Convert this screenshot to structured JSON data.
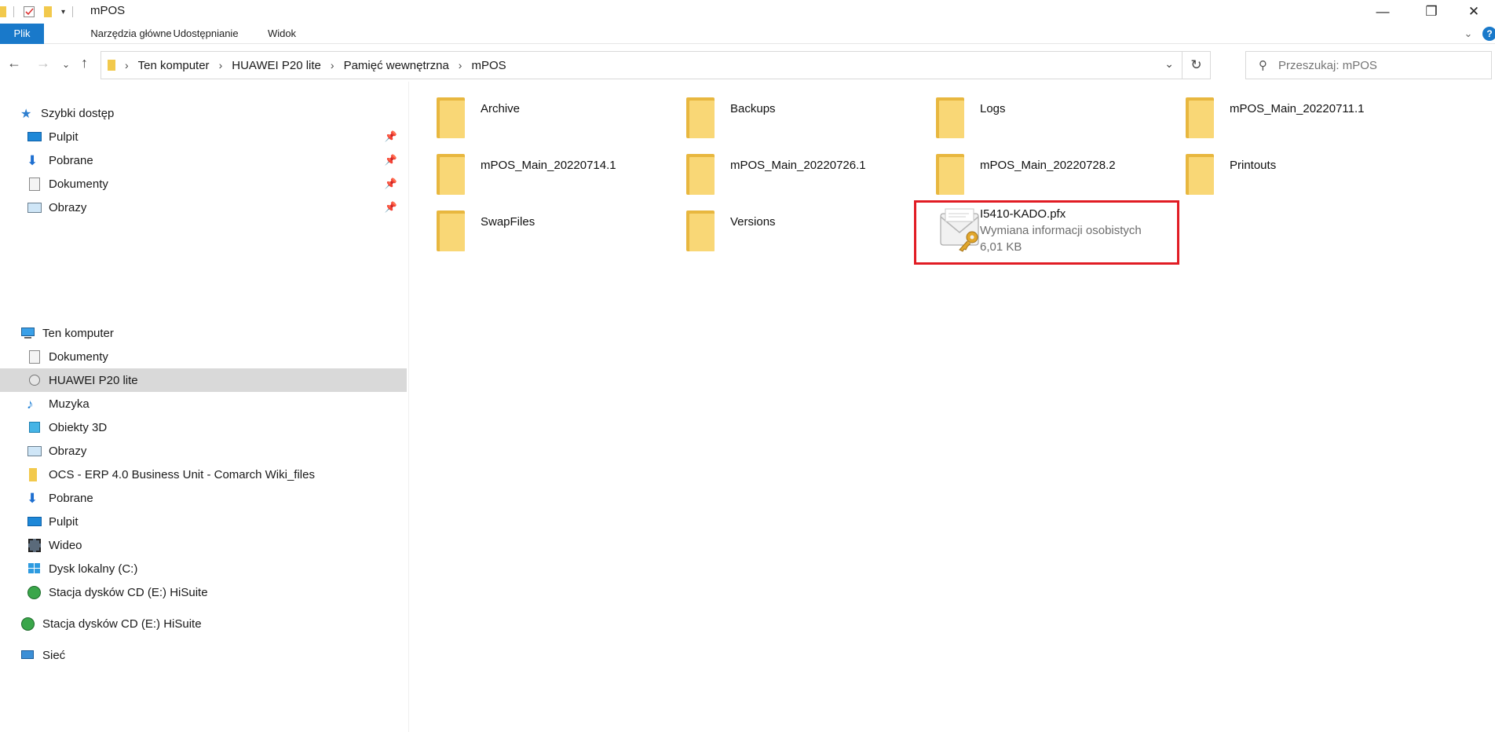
{
  "window": {
    "title": "mPOS",
    "minimize_glyph": "—",
    "restore_glyph": "❐",
    "close_glyph": "✕"
  },
  "ribbon": {
    "tabs": [
      "Plik",
      "Narzędzia główne",
      "Udostępnianie",
      "Widok"
    ],
    "help_glyph": "?",
    "expand_glyph": "⌄"
  },
  "address": {
    "breadcrumbs": [
      "Ten komputer",
      "HUAWEI P20 lite",
      "Pamięć wewnętrzna",
      "mPOS"
    ],
    "search_placeholder": "Przeszukaj: mPOS"
  },
  "nav": {
    "quick_access": {
      "label": "Szybki dostęp",
      "items": [
        "Pulpit",
        "Pobrane",
        "Dokumenty",
        "Obrazy"
      ]
    },
    "this_pc": {
      "label": "Ten komputer",
      "items": [
        "Dokumenty",
        "HUAWEI P20 lite",
        "Muzyka",
        "Obiekty 3D",
        "Obrazy",
        "OCS - ERP 4.0 Business Unit - Comarch Wiki_files",
        "Pobrane",
        "Pulpit",
        "Wideo",
        "Dysk lokalny (C:)",
        "Stacja dysków CD (E:) HiSuite"
      ]
    },
    "cd_drive": "Stacja dysków CD (E:) HiSuite",
    "network": "Sieć",
    "selected": "HUAWEI P20 lite"
  },
  "files": {
    "folders": [
      "Archive",
      "Backups",
      "Logs",
      "mPOS_Main_20220711.1",
      "mPOS_Main_20220714.1",
      "mPOS_Main_20220726.1",
      "mPOS_Main_20220728.2",
      "Printouts",
      "SwapFiles",
      "Versions"
    ],
    "pfx_file": {
      "name": "I5410-KADO.pfx",
      "type": "Wymiana informacji osobistych",
      "size": "6,01 KB",
      "highlighted": true,
      "highlight_color": "#e11c24"
    }
  },
  "colors": {
    "accent": "#1979ca",
    "selection": "#d9d9d9",
    "folder": "#f9d776"
  }
}
